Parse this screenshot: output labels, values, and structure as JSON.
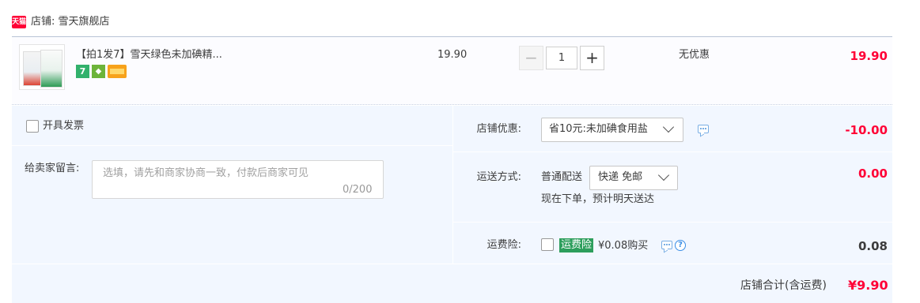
{
  "shop": {
    "badge": "天猫",
    "name": "店铺: 雪天旗舰店"
  },
  "item": {
    "title": "【拍1发7】雪天绿色未加碘精...",
    "service_icons": [
      "seven-day-return-icon",
      "guarantee-shield-icon",
      "credit-card-icon"
    ],
    "unit_price": "19.90",
    "quantity": "1",
    "quantity_minus": "−",
    "quantity_plus": "+",
    "discount": "无优惠",
    "subtotal": "19.90"
  },
  "invoice": {
    "label": "开具发票",
    "checked": false
  },
  "memo": {
    "label": "给卖家留言:",
    "placeholder": "选填，请先和商家协商一致，付款后商家可见",
    "count": "0/200"
  },
  "shop_promo": {
    "label": "店铺优惠:",
    "selected": "省10元:未加碘食用盐",
    "amount": "-10.00"
  },
  "shipping": {
    "label": "运送方式:",
    "method": "普通配送",
    "selected": "快递 免邮",
    "note": "现在下单，预计明天送达",
    "amount": "0.00"
  },
  "insurance": {
    "label": "运费险:",
    "badge": "运费险",
    "price": "¥0.08购买",
    "help": "?",
    "amount": "0.08",
    "checked": false
  },
  "total": {
    "label": "店铺合计(含运费)",
    "amount": "¥9.90"
  },
  "colors": {
    "accent_red": "#ff0036",
    "panel_bg": "#f2f7ff",
    "insurance_green": "#2d9e5c"
  }
}
